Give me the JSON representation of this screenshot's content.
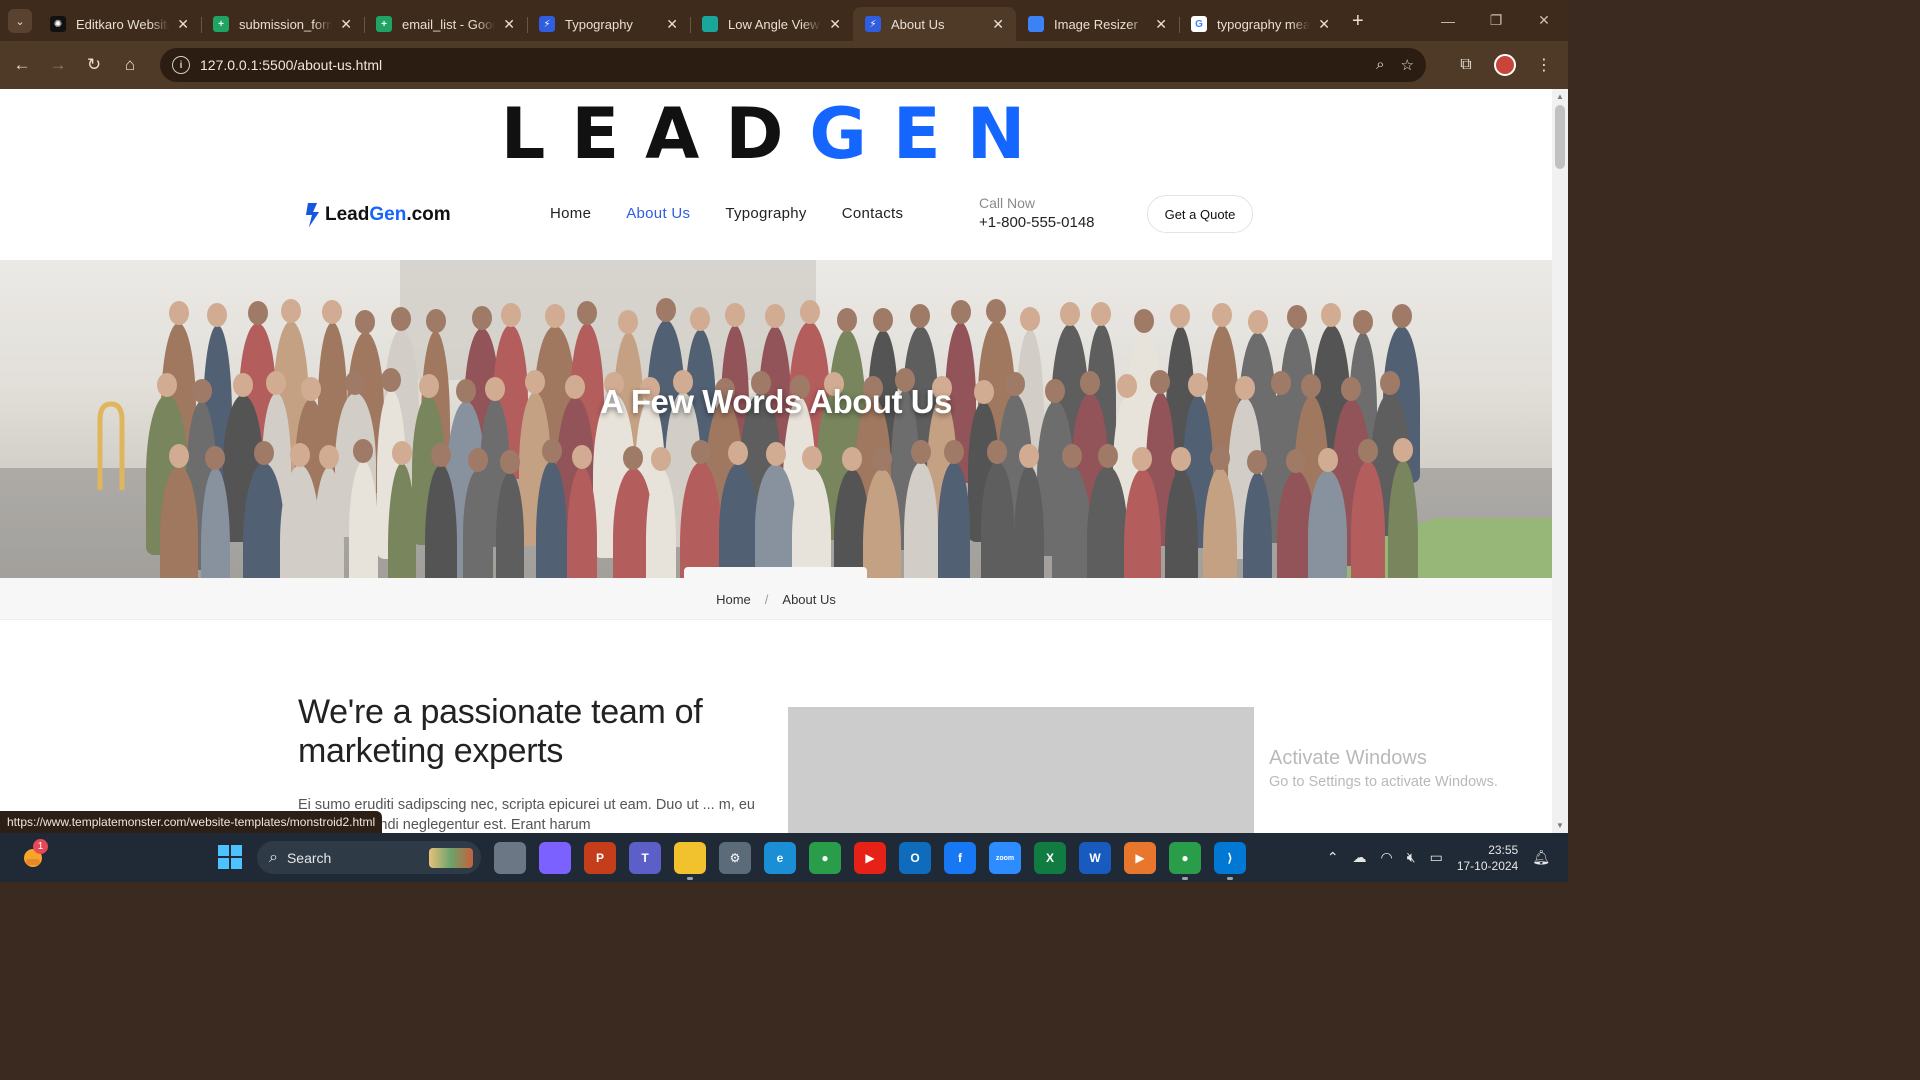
{
  "browser": {
    "tabs": [
      {
        "title": "Editkaro Website",
        "fav_color": "#111111",
        "fav_icon": "openai-icon"
      },
      {
        "title": "submission_form",
        "fav_color": "#1fa463",
        "fav_icon": "sheets-icon"
      },
      {
        "title": "email_list - Google",
        "fav_color": "#1fa463",
        "fav_icon": "sheets-icon"
      },
      {
        "title": "Typography",
        "fav_color": "#2f5ee0",
        "fav_icon": "bolt-icon"
      },
      {
        "title": "Low Angle View of",
        "fav_color": "#1aa69b",
        "fav_icon": "pexels-icon"
      },
      {
        "title": "About Us",
        "fav_color": "#2f5ee0",
        "fav_icon": "bolt-icon"
      },
      {
        "title": "Image Resizer",
        "fav_color": "#3b82f6",
        "fav_icon": "resize-icon"
      },
      {
        "title": "typography meaning",
        "fav_color": "#ffffff",
        "fav_icon": "google-icon"
      }
    ],
    "active_tab_index": 5,
    "url": "127.0.0.1:5500/about-us.html",
    "status_url": "https://www.templatemonster.com/website-templates/monstroid2.html"
  },
  "site": {
    "logo_big_dark": "LEAD",
    "logo_big_blue": "GEN",
    "brand_dark": "Lead",
    "brand_blue": "Gen",
    "brand_suffix": ".com",
    "accent": "#1565ff",
    "menu": [
      {
        "label": "Home",
        "active": false
      },
      {
        "label": "About Us",
        "active": true
      },
      {
        "label": "Typography",
        "active": false
      },
      {
        "label": "Contacts",
        "active": false
      }
    ],
    "call_label": "Call Now",
    "phone": "+1-800-555-0148",
    "quote_button": "Get a Quote",
    "hero_title": "A Few Words About Us",
    "breadcrumb": {
      "home": "Home",
      "separator": "/",
      "current": "About Us"
    },
    "headline": "We're a passionate team of marketing experts",
    "paragraph": "Ei sumo eruditi sadipscing nec, scripta epicurei ut eam. Duo ut ... m, eu soleat salutandi neglegentur est. Erant harum"
  },
  "watermark": {
    "line1": "Activate Windows",
    "line2": "Go to Settings to activate Windows."
  },
  "taskbar": {
    "search_placeholder": "Search",
    "notification_count": "1",
    "apps": [
      {
        "name": "file-explorer-mini",
        "color": "#6b7785",
        "label": ""
      },
      {
        "name": "copilot",
        "color": "#7b61ff",
        "label": ""
      },
      {
        "name": "powerpoint",
        "color": "#c43e1c",
        "label": "P"
      },
      {
        "name": "teams",
        "color": "#5b5fc7",
        "label": "T"
      },
      {
        "name": "file-explorer",
        "color": "#f2c12e",
        "label": ""
      },
      {
        "name": "settings",
        "color": "#5c6b7a",
        "label": "⚙"
      },
      {
        "name": "edge",
        "color": "#1a8fd6",
        "label": "e"
      },
      {
        "name": "chrome",
        "color": "#2a9d4a",
        "label": "●"
      },
      {
        "name": "youtube",
        "color": "#e62117",
        "label": "▶"
      },
      {
        "name": "outlook",
        "color": "#0f6cbd",
        "label": "O"
      },
      {
        "name": "facebook",
        "color": "#1877f2",
        "label": "f"
      },
      {
        "name": "zoom",
        "color": "#2d8cff",
        "label": "zoom"
      },
      {
        "name": "excel",
        "color": "#107c41",
        "label": "X"
      },
      {
        "name": "word",
        "color": "#185abd",
        "label": "W"
      },
      {
        "name": "media-player",
        "color": "#e8762d",
        "label": "▶"
      },
      {
        "name": "chrome-profile",
        "color": "#2a9d4a",
        "label": "●"
      },
      {
        "name": "vscode",
        "color": "#0078d4",
        "label": "⟩"
      }
    ],
    "time": "23:55",
    "date": "17-10-2024"
  }
}
